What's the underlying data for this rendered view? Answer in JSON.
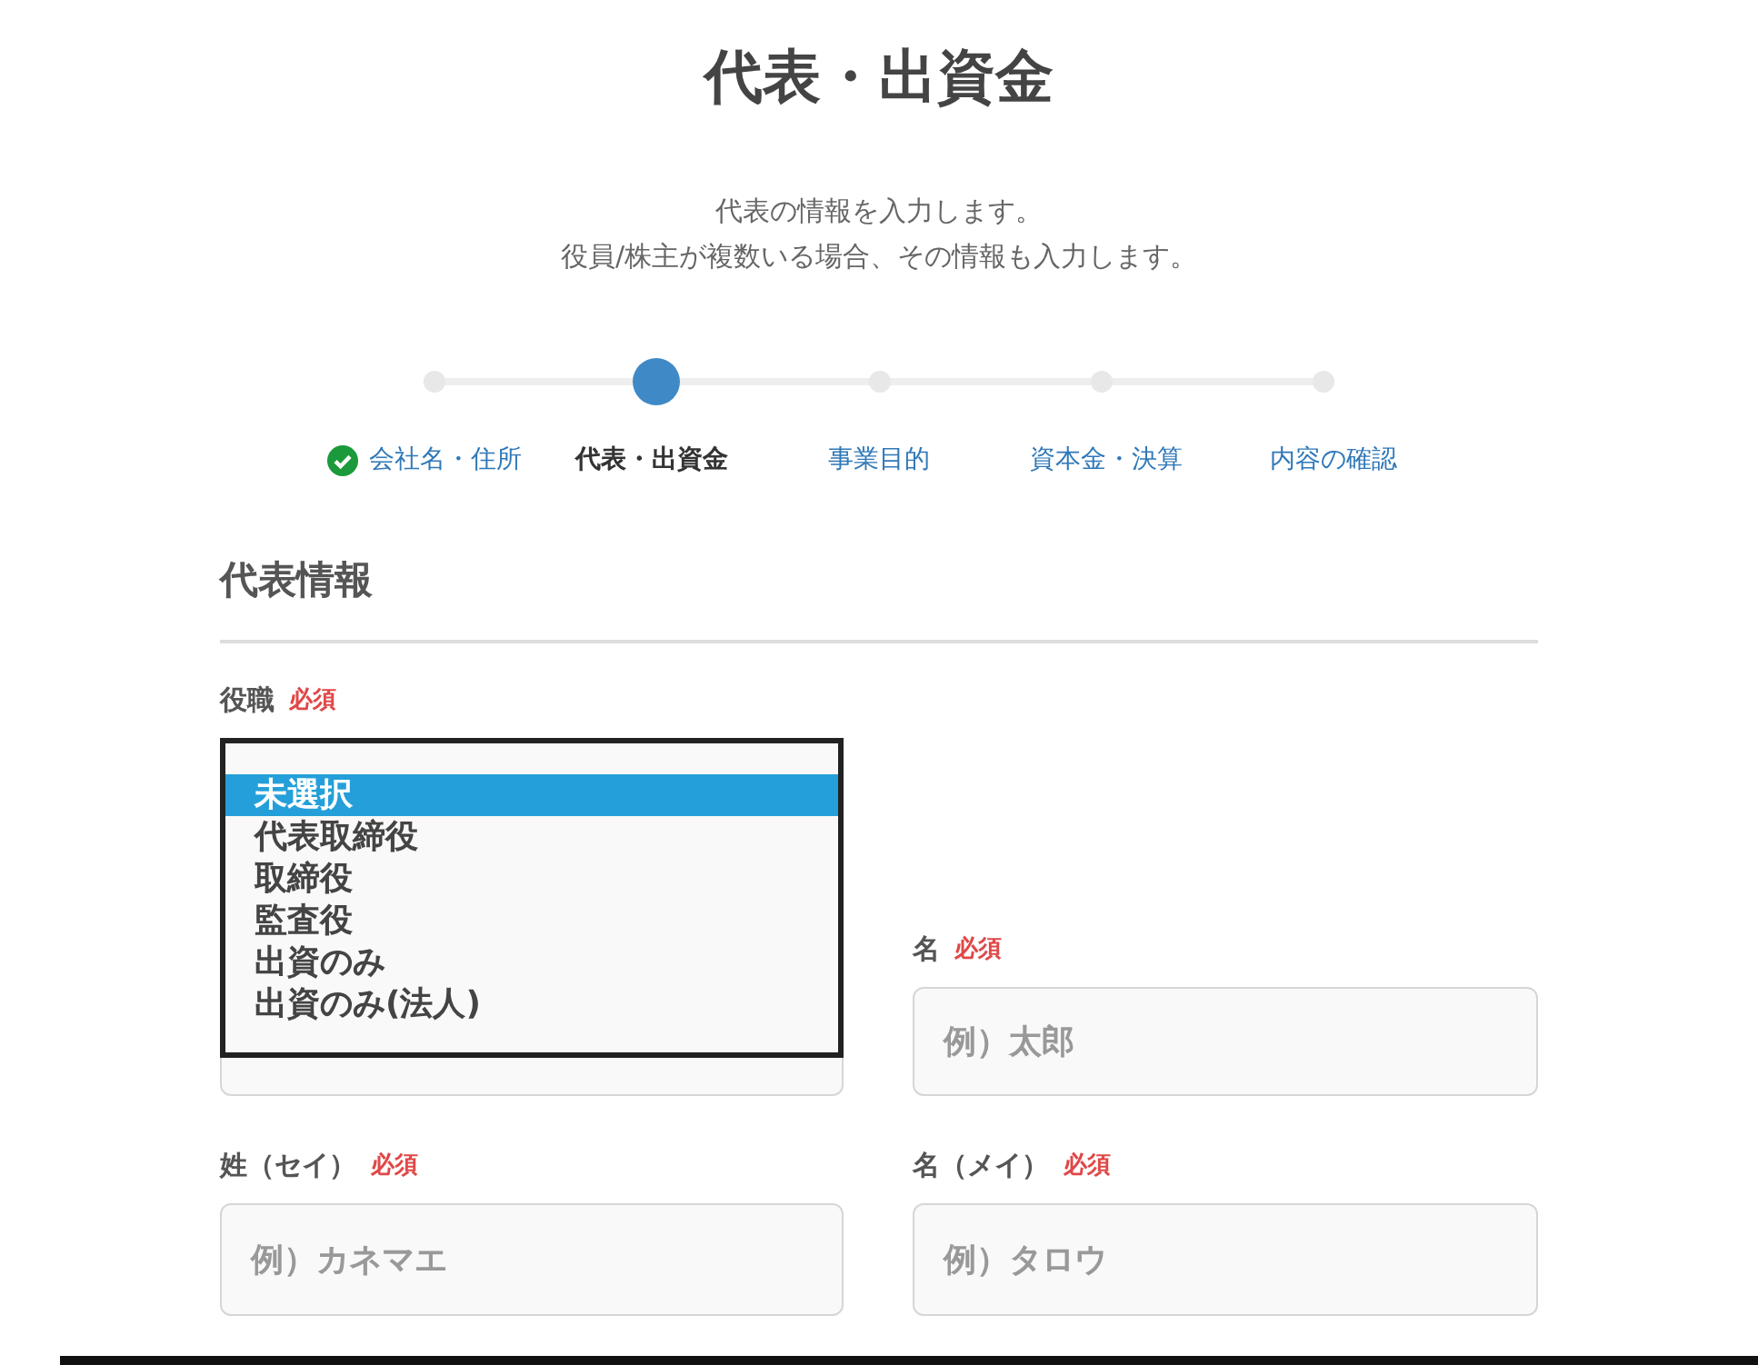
{
  "page_title": "代表・出資金",
  "description": [
    "代表の情報を入力します。",
    "役員/株主が複数いる場合、その情報も入力します。"
  ],
  "steps": [
    {
      "label": "会社名・住所",
      "done": true,
      "selected": false
    },
    {
      "label": "代表・出資金",
      "done": false,
      "selected": true
    },
    {
      "label": "事業目的",
      "done": false,
      "selected": false
    },
    {
      "label": "資本金・決算",
      "done": false,
      "selected": false
    },
    {
      "label": "内容の確認",
      "done": false,
      "selected": false
    }
  ],
  "section_title": "代表情報",
  "position_field": {
    "label": "役職",
    "required": "必須",
    "options": [
      {
        "label": "未選択",
        "selected": true
      },
      {
        "label": "代表取締役",
        "selected": false
      },
      {
        "label": "取締役",
        "selected": false
      },
      {
        "label": "監査役",
        "selected": false
      },
      {
        "label": "出資のみ",
        "selected": false
      },
      {
        "label": "出資のみ(法人)",
        "selected": false
      }
    ]
  },
  "first_name_field": {
    "label": "名",
    "required": "必須",
    "placeholder": "例）太郎"
  },
  "kana_fields": [
    {
      "label": "姓（セイ）",
      "required": "必須",
      "placeholder": "例）カネマエ"
    },
    {
      "label": "名（メイ）",
      "required": "必須",
      "placeholder": "例）タロウ"
    }
  ]
}
